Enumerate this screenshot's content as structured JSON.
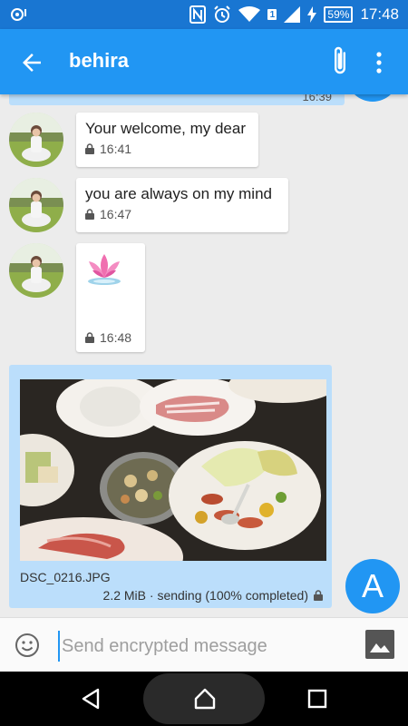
{
  "status_bar": {
    "battery": "59",
    "sim_slot": "1",
    "time": "17:48"
  },
  "toolbar": {
    "contact_name": "behira",
    "icons": [
      "back-arrow-icon",
      "paperclip-icon",
      "overflow-menu-icon"
    ]
  },
  "messages": [
    {
      "text": "Your welcome, my dear",
      "time": "16:41",
      "encrypted": true
    },
    {
      "text": "you are always on my mind",
      "time": "16:47",
      "encrypted": true
    },
    {
      "text": "",
      "time": "16:48",
      "encrypted": true,
      "sticker": "lotus-emoji"
    }
  ],
  "partial_message": {
    "time": "16:39"
  },
  "sent_file": {
    "name": "DSC_0216.JPG",
    "status": "2.2 MiB · sending (100% completed)",
    "progress_percent": 100
  },
  "self_avatar": {
    "letter": "A"
  },
  "composer": {
    "placeholder": "Send encrypted message"
  },
  "colors": {
    "toolbar": "#2196f3",
    "status_bar": "#1976d2",
    "sent_bubble": "#bbdefb"
  }
}
